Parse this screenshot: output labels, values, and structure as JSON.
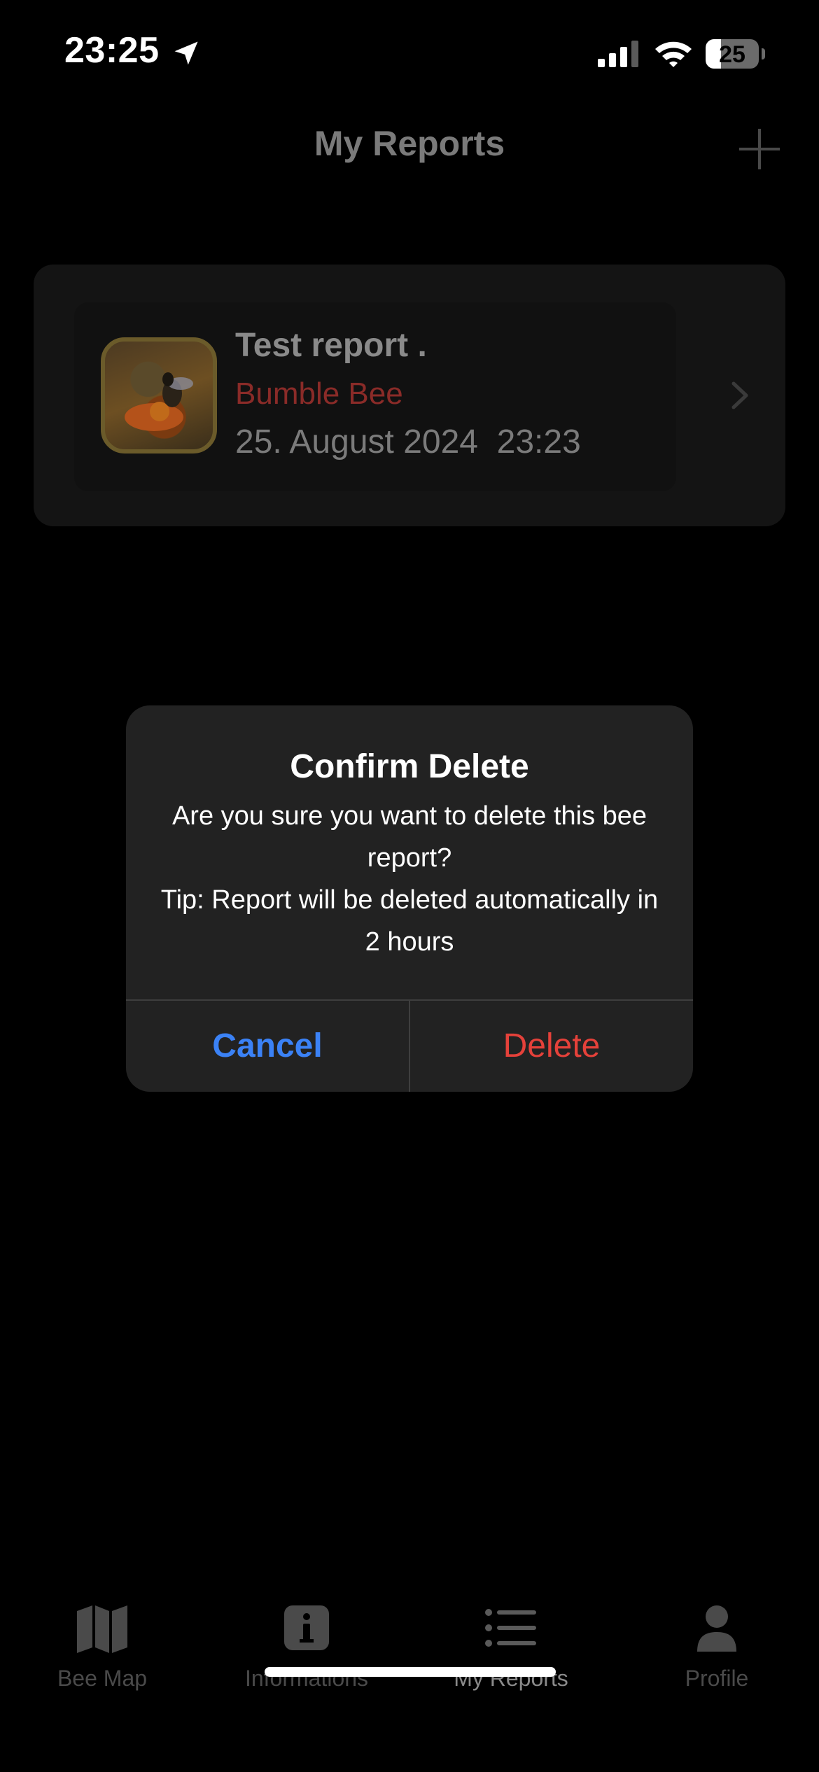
{
  "status_bar": {
    "time": "23:25",
    "battery_level": "25",
    "icons": [
      "location-arrow-icon",
      "cellular-signal-icon",
      "wifi-icon",
      "battery-icon"
    ]
  },
  "nav": {
    "title": "My Reports",
    "add_icon": "plus-icon"
  },
  "report": {
    "title": "Test report .",
    "species": "Bumble Bee",
    "date": "25. August 2024  23:23",
    "thumbnail_icon": "bee-photo-thumbnail",
    "chevron_icon": "chevron-right-icon"
  },
  "alert": {
    "title": "Confirm Delete",
    "message_line1": "Are you sure you want to delete this bee report?",
    "message_line2": "Tip: Report will be deleted automatically in 2 hours",
    "cancel_label": "Cancel",
    "delete_label": "Delete"
  },
  "tabs": [
    {
      "label": "Bee Map",
      "icon": "map-icon",
      "active": false
    },
    {
      "label": "Informations",
      "icon": "info-icon",
      "active": false
    },
    {
      "label": "My Reports",
      "icon": "list-icon",
      "active": true
    },
    {
      "label": "Profile",
      "icon": "person-icon",
      "active": false
    }
  ],
  "colors": {
    "background": "#000000",
    "alert_background": "#222222",
    "cancel": "#3b82f6",
    "delete": "#e5413a",
    "species": "#8a2b28"
  }
}
